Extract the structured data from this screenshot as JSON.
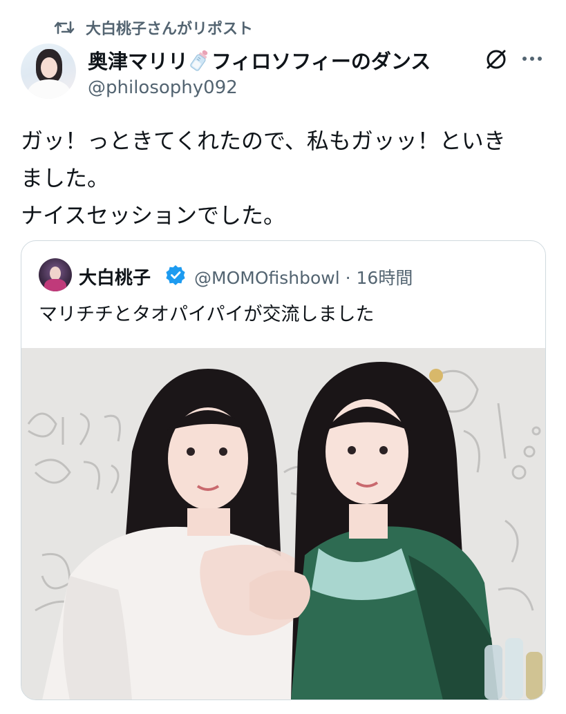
{
  "repost": {
    "label": "大白桃子さんがリポスト",
    "icon": "repost-icon"
  },
  "author": {
    "name_part1": "奥津マリリ",
    "name_emoji": "baby-bottle",
    "name_part2": "フィロソフィーのダンス",
    "handle": "@philosophy092"
  },
  "actions": {
    "grok_icon": "grok-icon",
    "more_icon": "more-icon"
  },
  "tweet": {
    "lines": [
      "ガッ！っときてくれたので、私もガッッ！といき",
      "ました。",
      "ナイスセッションでした。"
    ]
  },
  "quote": {
    "name": "大白桃子",
    "handle": "@MOMOfishbowl",
    "separator": "·",
    "time": "16時間",
    "text": "マリチチとタオパイパイが交流しました",
    "verified_color": "#1d9bf0"
  },
  "colors": {
    "text": "#0f1419",
    "muted": "#536471",
    "border": "#cfd9de",
    "accent": "#1d9bf0"
  }
}
